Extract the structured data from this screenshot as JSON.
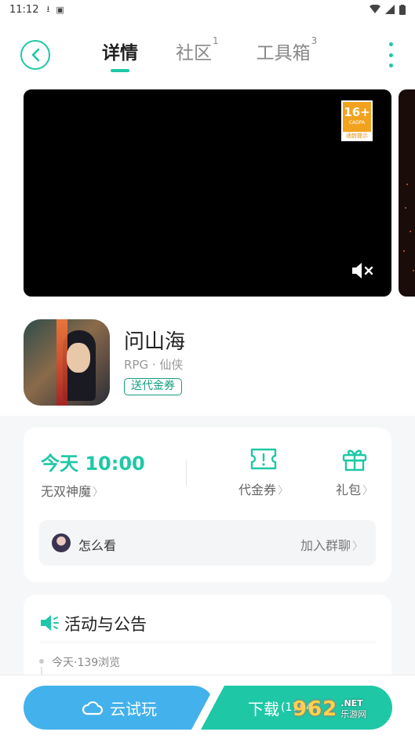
{
  "status_bar": {
    "time": "11:12"
  },
  "header": {
    "tabs": [
      {
        "label": "详情",
        "badge": ""
      },
      {
        "label": "社区",
        "badge": "1"
      },
      {
        "label": "工具箱",
        "badge": "3"
      }
    ]
  },
  "media": {
    "age_rating": "16+",
    "rating_org": "CADPA",
    "rating_tip": "适龄提示"
  },
  "game": {
    "title": "问山海",
    "tags": "RPG · 仙侠",
    "promo_tag": "送代金券"
  },
  "schedule_card": {
    "launch_time": "今天 10:00",
    "server_name": "无双神魔",
    "voucher_label": "代金券",
    "gift_label": "礼包",
    "group_question": "怎么看",
    "join_group_label": "加入群聊"
  },
  "announce_card": {
    "title": "活动与公告",
    "meta": "今天·139浏览"
  },
  "bottom": {
    "cloud_play_label": "云试玩",
    "download_label": "下载",
    "download_size": "(1764",
    "watermark_logo": "962",
    "watermark_suffix": ".NET",
    "watermark_cn": "乐游网"
  },
  "colors": {
    "accent": "#1ec8a7",
    "cloud_blue": "#43b1ec",
    "age_badge": "#f2a21d"
  }
}
